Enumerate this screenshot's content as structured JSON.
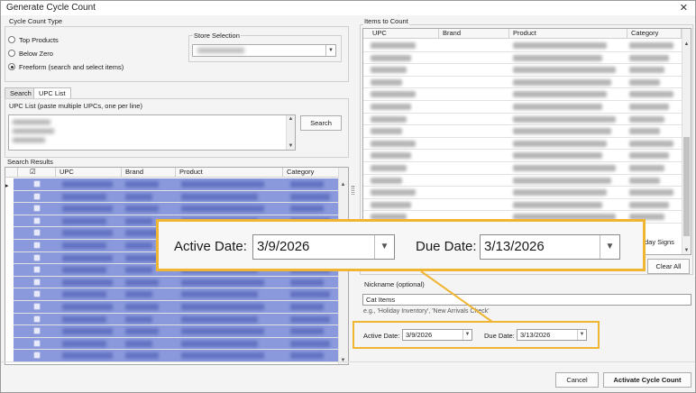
{
  "window": {
    "title": "Generate Cycle Count",
    "close_glyph": "✕"
  },
  "cycle_count_type": {
    "label": "Cycle Count Type",
    "options": [
      {
        "label": "Top Products",
        "selected": false
      },
      {
        "label": "Below Zero",
        "selected": false
      },
      {
        "label": "Freeform (search and select items)",
        "selected": true
      }
    ]
  },
  "store_selection": {
    "label": "Store Selection",
    "value": ""
  },
  "tabs": [
    {
      "label": "Search",
      "active": false
    },
    {
      "label": "UPC List",
      "active": true
    }
  ],
  "upc_list": {
    "label": "UPC List (paste multiple UPCs, one per line)",
    "search_button": "Search"
  },
  "search_results": {
    "label": "Search Results",
    "columns": [
      "",
      "UPC",
      "Brand",
      "Product",
      "Category"
    ],
    "current_row_marker": "▸",
    "row_count": 15
  },
  "items_to_count": {
    "label": "Items to Count",
    "columns": [
      "UPC",
      "Brand",
      "Product",
      "Category"
    ],
    "partial_text": "day Signs",
    "clear_all_button": "Clear All"
  },
  "nickname": {
    "label": "Nickname (optional)",
    "value": "Cat Items",
    "hint": "e.g., 'Holiday Inventory', 'New Arrivals Check'"
  },
  "dates": {
    "active_label": "Active Date:",
    "active_value": "3/9/2026",
    "due_label": "Due Date:",
    "due_value": "3/13/2026"
  },
  "footer": {
    "cancel_button": "Cancel",
    "activate_button": "Activate Cycle Count"
  },
  "colors": {
    "selection": "#8a98dc",
    "highlight": "#f0b532"
  },
  "icons": {
    "dropdown": "chevron-down-icon",
    "close": "close-icon",
    "checkbox": "checkbox-icon"
  }
}
